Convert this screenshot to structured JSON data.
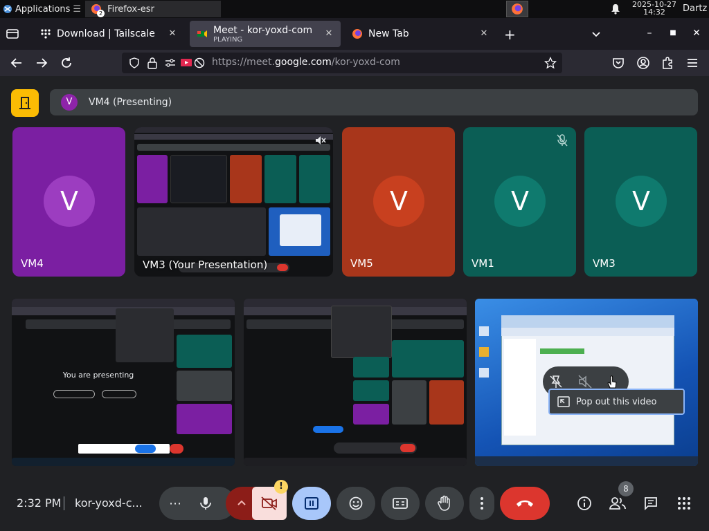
{
  "system_panel": {
    "applications_label": "Applications",
    "task_title": "Firefox-esr",
    "task_badge": "2",
    "clock_date": "2025-10-27",
    "clock_time": "14:32",
    "user": "Dartz"
  },
  "browser": {
    "tabs": [
      {
        "title": "Download | Tailscale",
        "subtitle": ""
      },
      {
        "title": "Meet - kor-yoxd-com",
        "subtitle": "PLAYING"
      },
      {
        "title": "New Tab",
        "subtitle": ""
      }
    ],
    "url_prefix": "https://meet.",
    "url_domain": "google.com",
    "url_suffix": "/kor-yoxd-com"
  },
  "meet": {
    "presenter_banner": {
      "avatar_letter": "V",
      "text": "VM4 (Presenting)"
    },
    "participants": [
      {
        "name": "VM4",
        "avatar": "V",
        "color": "#7b1fa2",
        "avatar_color": "#9c3dc0",
        "muted": false
      },
      {
        "name": "VM3 (Your Presentation)",
        "avatar": "",
        "color": "#111214",
        "avatar_color": "",
        "muted": true
      },
      {
        "name": "VM5",
        "avatar": "V",
        "color": "#a8361b",
        "avatar_color": "#c8401f",
        "muted": false
      },
      {
        "name": "VM1",
        "avatar": "V",
        "color": "#0b5e55",
        "avatar_color": "#0f7a6e",
        "muted": true
      },
      {
        "name": "VM3",
        "avatar": "V",
        "color": "#0b5e55",
        "avatar_color": "#0f7a6e",
        "muted": false
      }
    ],
    "presenting_screen_text": "You are presenting",
    "tooltip": "Pop out this video",
    "bottom": {
      "time": "2:32 PM",
      "meeting_code": "kor-yoxd-c...",
      "warning_badge": "!",
      "people_count": "8"
    }
  },
  "colors": {
    "accent_yellow": "#fbbc04",
    "hangup_red": "#dc362e",
    "present_blue": "#a8c7fa"
  }
}
